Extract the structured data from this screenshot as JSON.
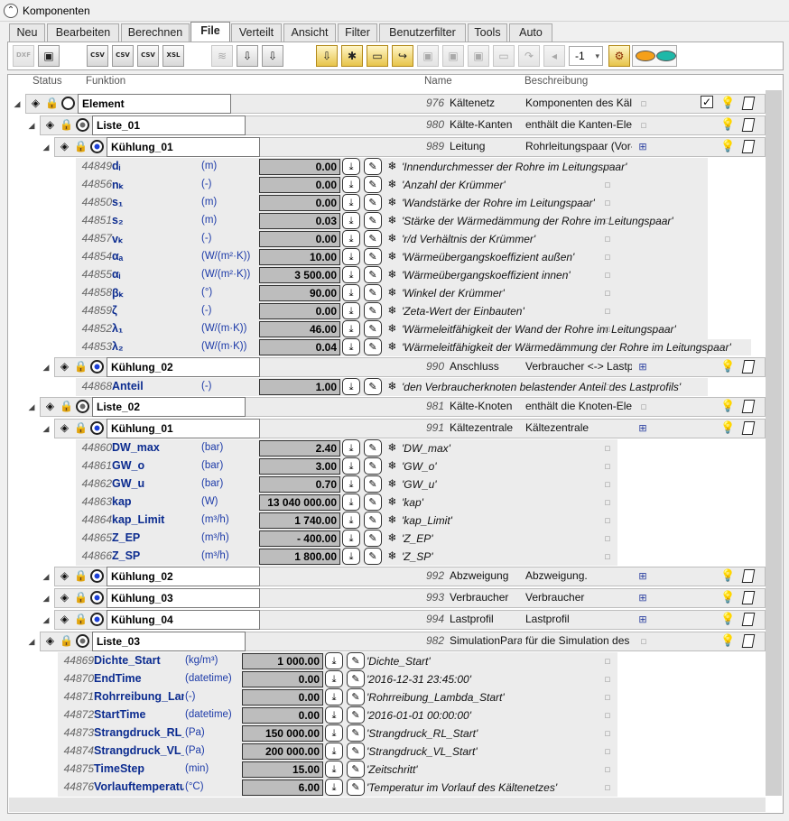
{
  "window": {
    "title": "Komponenten"
  },
  "tabs": [
    "Neu",
    "Bearbeiten",
    "Berechnen",
    "File",
    "Verteilt",
    "Ansicht",
    "Filter",
    "Benutzerfilter",
    "Tools",
    "Auto"
  ],
  "active_tab": "File",
  "toolbar": {
    "icons": [
      "dxf-import-icon",
      "save-icon",
      "csv-export-icon",
      "csv-export-2-icon",
      "csv-export-3-icon",
      "xsl-export-icon",
      "layers-icon",
      "export-project-icon",
      "export-project-2-icon",
      "folder-import-icon",
      "folder-new-icon",
      "folder-open-icon",
      "folder-move-icon",
      "disk-icon",
      "disk-import-icon",
      "disk-export-icon",
      "folder-up-icon",
      "redo-icon",
      "speaker-icon",
      "settings-gears-icon"
    ],
    "level_select": "-1",
    "dxf_label": "DXF",
    "csv_label": "CSV",
    "xsl_label": "XSL"
  },
  "columns": {
    "status": "Status",
    "funktion": "Funktion",
    "name": "Name",
    "beschreibung": "Beschreibung"
  },
  "rows": {
    "element": {
      "label": "Element",
      "id": "976",
      "name": "Kältenetz",
      "desc": "Komponenten des Kält"
    },
    "liste01": {
      "label": "Liste_01",
      "id": "980",
      "name": "Kälte-Kanten",
      "desc": "enthält die Kanten-Eler"
    },
    "kuehlung01a": {
      "label": "Kühlung_01",
      "id": "989",
      "name": "Leitung",
      "desc": "Rohrleitungspaar (Vor-"
    },
    "kuehlung02a": {
      "label": "Kühlung_02",
      "id": "990",
      "name": "Anschluss",
      "desc": "Verbraucher <-> Lastp"
    },
    "liste02": {
      "label": "Liste_02",
      "id": "981",
      "name": "Kälte-Knoten",
      "desc": "enthält die Knoten-Ele"
    },
    "kuehlung01b": {
      "label": "Kühlung_01",
      "id": "991",
      "name": "Kältezentrale",
      "desc": "Kältezentrale"
    },
    "kuehlung02b": {
      "label": "Kühlung_02",
      "id": "992",
      "name": "Abzweigung",
      "desc": "Abzweigung."
    },
    "kuehlung03": {
      "label": "Kühlung_03",
      "id": "993",
      "name": "Verbraucher",
      "desc": "Verbraucher"
    },
    "kuehlung04": {
      "label": "Kühlung_04",
      "id": "994",
      "name": "Lastprofil",
      "desc": "Lastprofil"
    },
    "liste03": {
      "label": "Liste_03",
      "id": "982",
      "name": "SimulationPara",
      "desc": "für die Simulation des"
    }
  },
  "params_leitung": [
    {
      "id": "44849",
      "name": "dᵢ",
      "unit": "(m)",
      "value": "0.00",
      "desc": "'Innendurchmesser der Rohre im Leitungspaar'"
    },
    {
      "id": "44856",
      "name": "nₖ",
      "unit": "(-)",
      "value": "0.00",
      "desc": "'Anzahl der Krümmer'"
    },
    {
      "id": "44850",
      "name": "s₁",
      "unit": "(m)",
      "value": "0.00",
      "desc": "'Wandstärke der Rohre im Leitungspaar'"
    },
    {
      "id": "44851",
      "name": "s₂",
      "unit": "(m)",
      "value": "0.03",
      "desc": "'Stärke der Wärmedämmung der Rohre im Leitungspaar'"
    },
    {
      "id": "44857",
      "name": "vₖ",
      "unit": "(-)",
      "value": "0.00",
      "desc": "'r/d Verhältnis der Krümmer'"
    },
    {
      "id": "44854",
      "name": "αₐ",
      "unit": "(W/(m²·K))",
      "value": "10.00",
      "desc": "'Wärmeübergangskoeffizient außen'"
    },
    {
      "id": "44855",
      "name": "αᵢ",
      "unit": "(W/(m²·K))",
      "value": "3 500.00",
      "desc": "'Wärmeübergangskoeffizient innen'"
    },
    {
      "id": "44858",
      "name": "βₖ",
      "unit": "(°)",
      "value": "90.00",
      "desc": "'Winkel der Krümmer'"
    },
    {
      "id": "44859",
      "name": "ζ",
      "unit": "(-)",
      "value": "0.00",
      "desc": "'Zeta-Wert der Einbauten'"
    },
    {
      "id": "44852",
      "name": "λ₁",
      "unit": "(W/(m·K))",
      "value": "46.00",
      "desc": "'Wärmeleitfähigkeit der Wand der Rohre im Leitungspaar'"
    },
    {
      "id": "44853",
      "name": "λ₂",
      "unit": "(W/(m·K))",
      "value": "0.04",
      "desc": "'Wärmeleitfähigkeit der Wärmedämmung der Rohre im Leitungspaar'"
    }
  ],
  "params_anschluss": [
    {
      "id": "44868",
      "name": "Anteil",
      "unit": "(-)",
      "value": "1.00",
      "desc": "'den Verbraucherknoten belastender Anteil des Lastprofils'"
    }
  ],
  "params_kaeltezentrale": [
    {
      "id": "44860",
      "name": "DW_max",
      "unit": "(bar)",
      "value": "2.40",
      "desc": "'DW_max'"
    },
    {
      "id": "44861",
      "name": "GW_o",
      "unit": "(bar)",
      "value": "3.00",
      "desc": "'GW_o'"
    },
    {
      "id": "44862",
      "name": "GW_u",
      "unit": "(bar)",
      "value": "0.70",
      "desc": "'GW_u'"
    },
    {
      "id": "44863",
      "name": "kap",
      "unit": "(W)",
      "value": "13 040 000.00",
      "desc": "'kap'"
    },
    {
      "id": "44864",
      "name": "kap_Limit",
      "unit": "(m³/h)",
      "value": "1 740.00",
      "desc": "'kap_Limit'"
    },
    {
      "id": "44865",
      "name": "Z_EP",
      "unit": "(m³/h)",
      "value": "-  400.00",
      "desc": "'Z_EP'"
    },
    {
      "id": "44866",
      "name": "Z_SP",
      "unit": "(m³/h)",
      "value": "1 800.00",
      "desc": "'Z_SP'"
    }
  ],
  "params_simulation": [
    {
      "id": "44869",
      "name": "Dichte_Start",
      "unit": "(kg/m³)",
      "value": "1 000.00",
      "desc": "'Dichte_Start'"
    },
    {
      "id": "44870",
      "name": "EndTime",
      "unit": "(datetime)",
      "value": "0.00",
      "desc": "'2016-12-31 23:45:00'"
    },
    {
      "id": "44871",
      "name": "Rohrreibung_Lamb",
      "unit": "(-)",
      "value": "0.00",
      "desc": "'Rohrreibung_Lambda_Start'"
    },
    {
      "id": "44872",
      "name": "StartTime",
      "unit": "(datetime)",
      "value": "0.00",
      "desc": "'2016-01-01 00:00:00'"
    },
    {
      "id": "44873",
      "name": "Strangdruck_RL_St",
      "unit": "(Pa)",
      "value": "150 000.00",
      "desc": "'Strangdruck_RL_Start'"
    },
    {
      "id": "44874",
      "name": "Strangdruck_VL_St",
      "unit": "(Pa)",
      "value": "200 000.00",
      "desc": "'Strangdruck_VL_Start'"
    },
    {
      "id": "44875",
      "name": "TimeStep",
      "unit": "(min)",
      "value": "15.00",
      "desc": "'Zeitschritt'"
    },
    {
      "id": "44876",
      "name": "Vorlauftemperatu",
      "unit": "(°C)",
      "value": "6.00",
      "desc": "'Temperatur im Vorlauf des Kältenetzes'"
    }
  ],
  "colors": {
    "accent_orange": "#f5a01a",
    "accent_teal": "#1fb8a8",
    "param_name": "#0b2b8f",
    "value_fill": "#bdbdbd"
  }
}
